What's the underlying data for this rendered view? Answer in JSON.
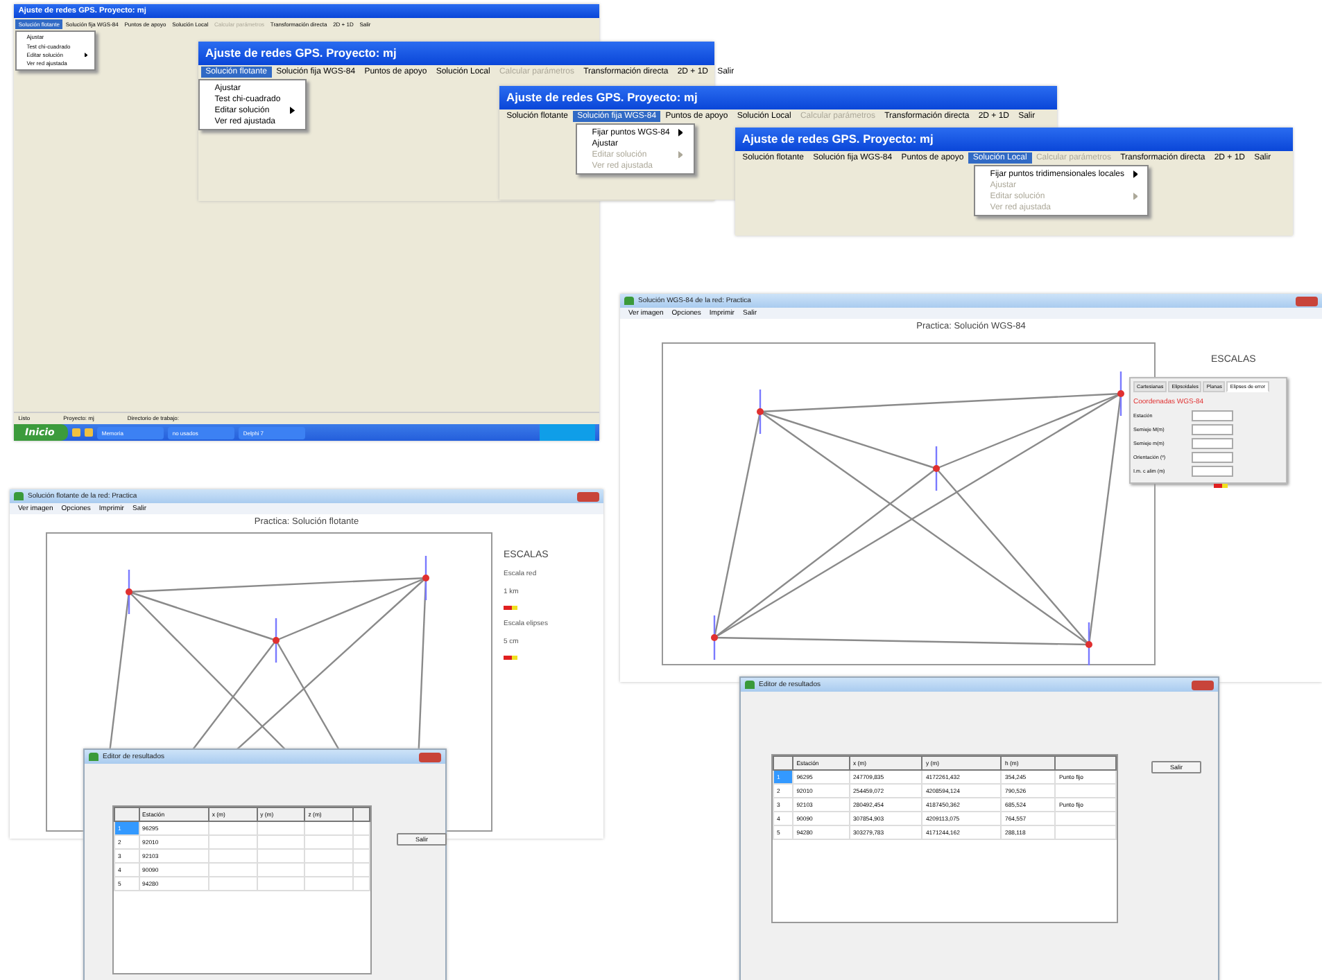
{
  "menu_windows": [
    {
      "title": "Ajuste de redes GPS. Proyecto: mj",
      "menu": [
        {
          "label": "Solución flotante",
          "selected": true,
          "disabled": false
        },
        {
          "label": "Solución fija WGS-84",
          "selected": false,
          "disabled": false
        },
        {
          "label": "Puntos de apoyo",
          "selected": false,
          "disabled": false
        },
        {
          "label": "Solución Local",
          "selected": false,
          "disabled": false
        },
        {
          "label": "Calcular parámetros",
          "selected": false,
          "disabled": true
        },
        {
          "label": "Transformación directa",
          "selected": false,
          "disabled": false
        },
        {
          "label": "2D + 1D",
          "selected": false,
          "disabled": false
        },
        {
          "label": "Salir",
          "selected": false,
          "disabled": false
        }
      ],
      "dropdown": [
        {
          "label": "Ajustar",
          "disabled": false,
          "submenu": false
        },
        {
          "label": "Test chi-cuadrado",
          "disabled": false,
          "submenu": false
        },
        {
          "label": "Editar solución",
          "disabled": false,
          "submenu": true
        },
        {
          "label": "Ver red ajustada",
          "disabled": false,
          "submenu": false
        }
      ],
      "status_bar": [
        "Listo",
        "Proyecto: mj",
        "Directorio de trabajo:"
      ],
      "taskbar": {
        "start": "Inicio",
        "tasks": [
          "Memoria",
          "no usados",
          "Delphi 7"
        ]
      }
    },
    {
      "title": "Ajuste de redes GPS. Proyecto: mj",
      "menu": [
        {
          "label": "Solución flotante",
          "selected": true,
          "disabled": false
        },
        {
          "label": "Solución fija WGS-84",
          "selected": false,
          "disabled": false
        },
        {
          "label": "Puntos de apoyo",
          "selected": false,
          "disabled": false
        },
        {
          "label": "Solución Local",
          "selected": false,
          "disabled": false
        },
        {
          "label": "Calcular parámetros",
          "selected": false,
          "disabled": true
        },
        {
          "label": "Transformación directa",
          "selected": false,
          "disabled": false
        },
        {
          "label": "2D + 1D",
          "selected": false,
          "disabled": false
        },
        {
          "label": "Salir",
          "selected": false,
          "disabled": false
        }
      ],
      "dropdown": [
        {
          "label": "Ajustar",
          "disabled": false,
          "submenu": false
        },
        {
          "label": "Test chi-cuadrado",
          "disabled": false,
          "submenu": false
        },
        {
          "label": "Editar solución",
          "disabled": false,
          "submenu": true
        },
        {
          "label": "Ver red ajustada",
          "disabled": false,
          "submenu": false
        }
      ]
    },
    {
      "title": "Ajuste de redes GPS. Proyecto: mj",
      "menu": [
        {
          "label": "Solución flotante",
          "selected": false,
          "disabled": false
        },
        {
          "label": "Solución fija WGS-84",
          "selected": true,
          "disabled": false
        },
        {
          "label": "Puntos de apoyo",
          "selected": false,
          "disabled": false
        },
        {
          "label": "Solución Local",
          "selected": false,
          "disabled": false
        },
        {
          "label": "Calcular parámetros",
          "selected": false,
          "disabled": true
        },
        {
          "label": "Transformación directa",
          "selected": false,
          "disabled": false
        },
        {
          "label": "2D + 1D",
          "selected": false,
          "disabled": false
        },
        {
          "label": "Salir",
          "selected": false,
          "disabled": false
        }
      ],
      "dropdown": [
        {
          "label": "Fijar puntos WGS-84",
          "disabled": false,
          "submenu": true
        },
        {
          "label": "Ajustar",
          "disabled": false,
          "submenu": false
        },
        {
          "label": "Editar solución",
          "disabled": true,
          "submenu": true
        },
        {
          "label": "Ver red ajustada",
          "disabled": true,
          "submenu": false
        }
      ]
    },
    {
      "title": "Ajuste de redes GPS. Proyecto: mj",
      "menu": [
        {
          "label": "Solución flotante",
          "selected": false,
          "disabled": false
        },
        {
          "label": "Solución fija WGS-84",
          "selected": false,
          "disabled": false
        },
        {
          "label": "Puntos de apoyo",
          "selected": false,
          "disabled": false
        },
        {
          "label": "Solución Local",
          "selected": true,
          "disabled": false
        },
        {
          "label": "Calcular parámetros",
          "selected": false,
          "disabled": true
        },
        {
          "label": "Transformación directa",
          "selected": false,
          "disabled": false
        },
        {
          "label": "2D + 1D",
          "selected": false,
          "disabled": false
        },
        {
          "label": "Salir",
          "selected": false,
          "disabled": false
        }
      ],
      "dropdown": [
        {
          "label": "Fijar puntos tridimensionales locales",
          "disabled": false,
          "submenu": true
        },
        {
          "label": "Ajustar",
          "disabled": true,
          "submenu": false
        },
        {
          "label": "Editar solución",
          "disabled": true,
          "submenu": true
        },
        {
          "label": "Ver red ajustada",
          "disabled": true,
          "submenu": false
        }
      ]
    }
  ],
  "plot_windows": [
    {
      "title": "Solución WGS-84 de la red: Practica",
      "menu": [
        "Ver imagen",
        "Opciones",
        "Imprimir",
        "Salir"
      ],
      "plot_title": "Practica: Solución WGS-84",
      "scales_title": "ESCALAS",
      "panel": {
        "tabs": [
          {
            "label": "Cartesianas",
            "selected": false
          },
          {
            "label": "Elipsoidales",
            "selected": false
          },
          {
            "label": "Planas",
            "selected": false
          },
          {
            "label": "Elipses de error",
            "selected": true
          }
        ],
        "heading": "Coordenadas WGS-84",
        "fields": [
          "Estación",
          "Semieje M(m)",
          "Semieje m(m)",
          "Orientación (º)",
          "I.m. c alim (m)"
        ]
      }
    },
    {
      "title": "Solución flotante de la red: Practica",
      "menu": [
        "Ver imagen",
        "Opciones",
        "Imprimir",
        "Salir"
      ],
      "plot_title": "Practica: Solución flotante",
      "scales_title": "ESCALAS",
      "scales": [
        "Escala red",
        "1 km",
        "Escala elipses",
        "5 cm"
      ]
    }
  ],
  "editors": [
    {
      "title": "Editor de resultados",
      "columns": [
        "",
        "Estación",
        "x (m)",
        "y (m)",
        "z (m)",
        ""
      ],
      "button": "Salir",
      "rows": [
        {
          "cells": [
            "1",
            "96295"
          ],
          "selected": true
        },
        {
          "cells": [
            "2",
            "92010"
          ],
          "selected": false
        },
        {
          "cells": [
            "3",
            "92103"
          ],
          "selected": false
        },
        {
          "cells": [
            "4",
            "90090"
          ],
          "selected": false
        },
        {
          "cells": [
            "5",
            "94280"
          ],
          "selected": false
        }
      ]
    },
    {
      "title": "Editor de resultados",
      "columns": [
        "",
        "Estación",
        "x (m)",
        "y (m)",
        "h (m)",
        ""
      ],
      "button": "Salir",
      "rows": [
        {
          "cells": [
            "1",
            "96295",
            "247709,835",
            "4172261,432",
            "354,245",
            "Punto fijo"
          ],
          "selected": true
        },
        {
          "cells": [
            "2",
            "92010",
            "254459,072",
            "4208594,124",
            "790,526"
          ],
          "selected": false
        },
        {
          "cells": [
            "3",
            "92103",
            "280492,454",
            "4187450,362",
            "685,524",
            "Punto fijo"
          ],
          "selected": false
        },
        {
          "cells": [
            "4",
            "90090",
            "307854,903",
            "4209113,075",
            "764,557"
          ],
          "selected": false
        },
        {
          "cells": [
            "5",
            "94280",
            "303279,783",
            "4171244,162",
            "288,118"
          ],
          "selected": false
        }
      ]
    }
  ]
}
